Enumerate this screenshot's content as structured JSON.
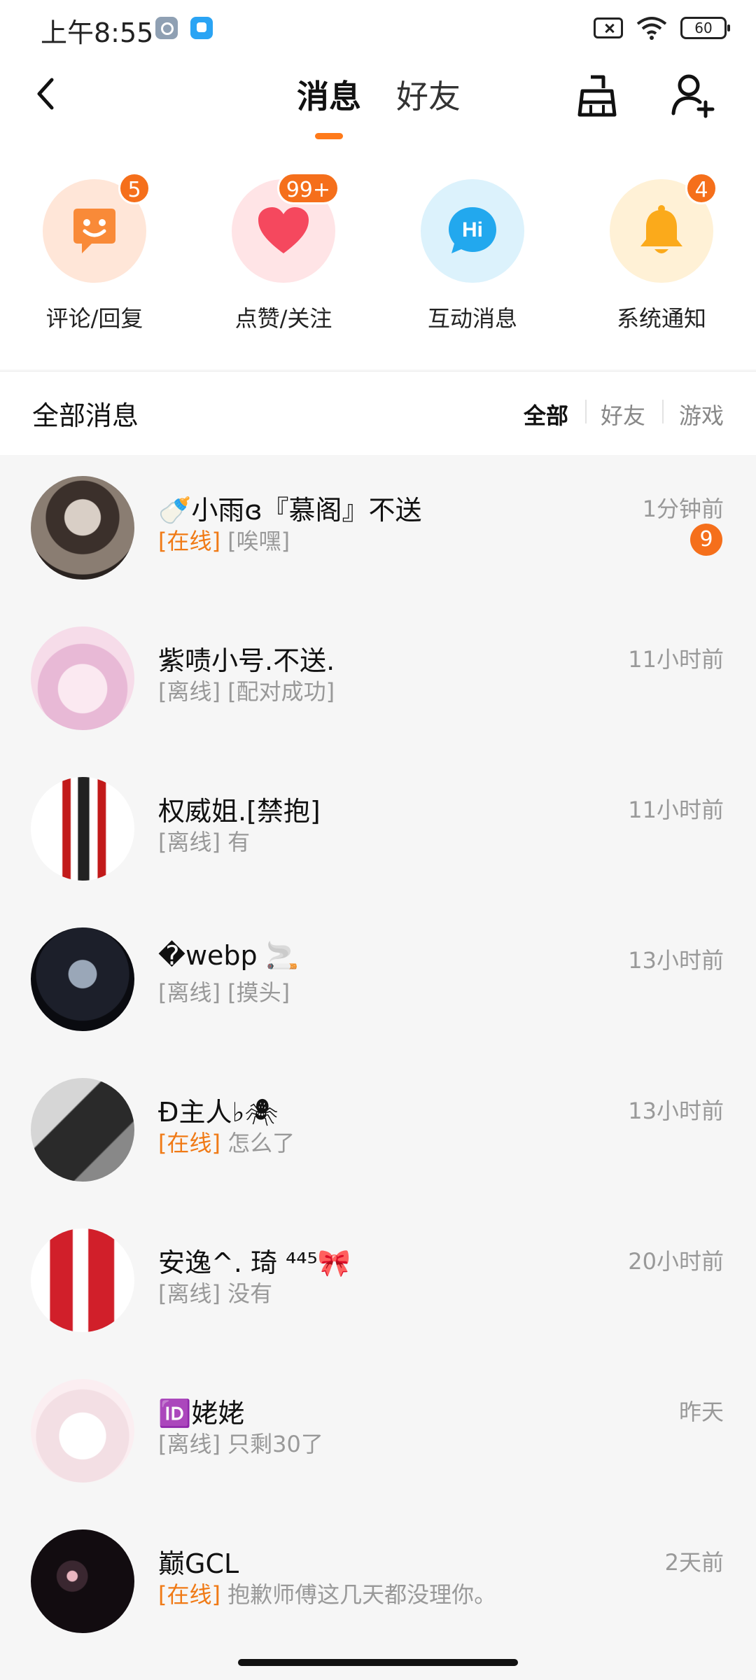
{
  "status_bar": {
    "time": "上午8:55",
    "battery": "60"
  },
  "header": {
    "tabs": [
      "消息",
      "好友"
    ],
    "accent": "#ff7a1a"
  },
  "quick_actions": [
    {
      "label": "评论/回复",
      "badge": "5",
      "icon": "comment-icon",
      "bg": "#ffe6d8"
    },
    {
      "label": "点赞/关注",
      "badge": "99+",
      "icon": "heart-icon",
      "bg": "#ffe4e6"
    },
    {
      "label": "互动消息",
      "badge": "",
      "icon": "hi-bubble-icon",
      "bg": "#dcf2fc"
    },
    {
      "label": "系统通知",
      "badge": "4",
      "icon": "bell-icon",
      "bg": "#fff1d6"
    }
  ],
  "all_messages": {
    "title": "全部消息",
    "filters": [
      "全部",
      "好友",
      "游戏"
    ]
  },
  "conversations": [
    {
      "name": "🍼小雨ɞ『慕阁』不送",
      "status": "[在线]",
      "online": true,
      "preview": "[唉嘿]",
      "time": "1分钟前",
      "unread": "9"
    },
    {
      "name": "紫啧小号.不送.",
      "status": "[离线]",
      "online": false,
      "preview": "[配对成功]",
      "time": "11小时前",
      "unread": ""
    },
    {
      "name": "权威姐.[禁抱]",
      "status": "[离线]",
      "online": false,
      "preview": "有",
      "time": "11小时前",
      "unread": ""
    },
    {
      "name": "�webp 🚬",
      "status": "[离线]",
      "online": false,
      "preview": "[摸头]",
      "time": "13小时前",
      "unread": ""
    },
    {
      "name": "Đ主人♭🕷",
      "status": "[在线]",
      "online": true,
      "preview": "怎么了",
      "time": "13小时前",
      "unread": ""
    },
    {
      "name": "安逸^. 琦 ⁴⁴⁵🎀",
      "status": "[离线]",
      "online": false,
      "preview": "没有",
      "time": "20小时前",
      "unread": ""
    },
    {
      "name": "🆔姥姥",
      "status": "[离线]",
      "online": false,
      "preview": "只剩30了",
      "time": "昨天",
      "unread": ""
    },
    {
      "name": "巅GCL",
      "status": "[在线]",
      "online": true,
      "preview": "抱歉师傅这几天都没理你。",
      "time": "2天前",
      "unread": ""
    }
  ]
}
